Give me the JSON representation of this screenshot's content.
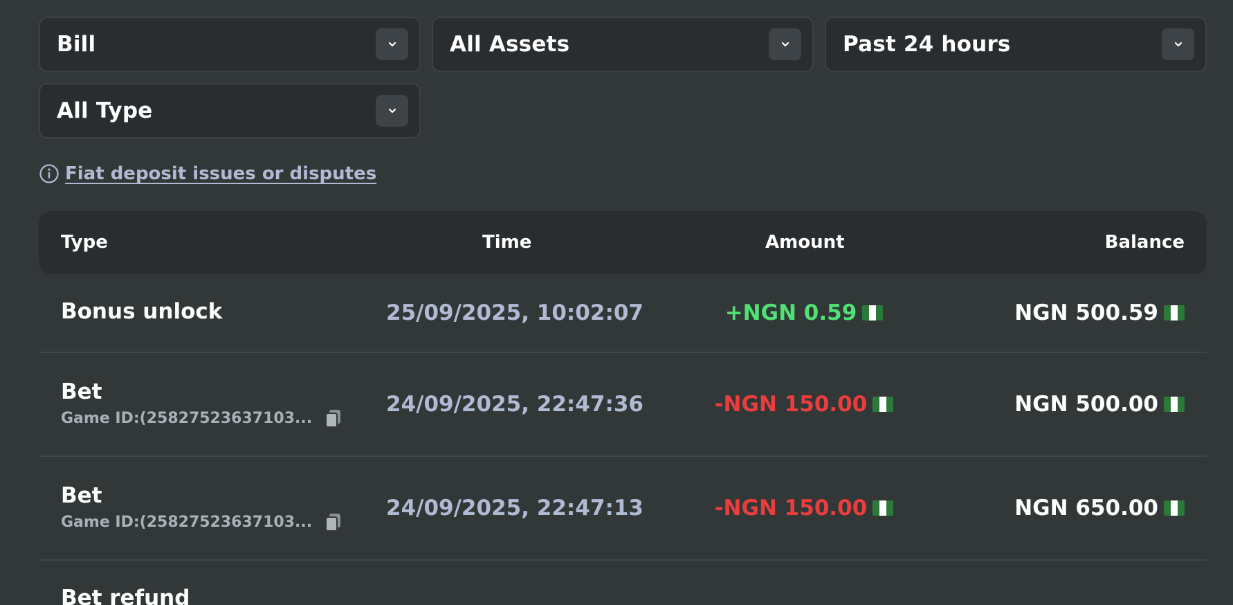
{
  "filters": {
    "bill": {
      "label": "Bill"
    },
    "assets": {
      "label": "All Assets"
    },
    "period": {
      "label": "Past 24 hours"
    },
    "type": {
      "label": "All Type"
    }
  },
  "dispute_link": {
    "label": "Fiat deposit issues or disputes"
  },
  "table": {
    "headers": {
      "type": "Type",
      "time": "Time",
      "amount": "Amount",
      "balance": "Balance"
    },
    "rows": [
      {
        "type": "Bonus unlock",
        "game_id": "",
        "time": "25/09/2025, 10:02:07",
        "amount": "+NGN 0.59",
        "amount_sign": "positive",
        "balance": "NGN 500.59"
      },
      {
        "type": "Bet",
        "game_id": "Game ID:(25827523637103...",
        "time": "24/09/2025, 22:47:36",
        "amount": "-NGN 150.00",
        "amount_sign": "negative",
        "balance": "NGN 500.00"
      },
      {
        "type": "Bet",
        "game_id": "Game ID:(25827523637103...",
        "time": "24/09/2025, 22:47:13",
        "amount": "-NGN 150.00",
        "amount_sign": "negative",
        "balance": "NGN 650.00"
      },
      {
        "type": "Bet refund",
        "game_id": "",
        "time": "",
        "amount": "",
        "amount_sign": "positive",
        "balance": ""
      }
    ]
  },
  "icons": {
    "dropdown": "chevron-down-icon",
    "info": "info-icon",
    "copy": "copy-icon",
    "currency_flag": "nigeria-flag-icon"
  },
  "colors": {
    "background": "#323738",
    "panel": "#292d2f",
    "positive": "#4fe076",
    "negative": "#ea3e3e",
    "muted_text": "#b1bad3"
  }
}
